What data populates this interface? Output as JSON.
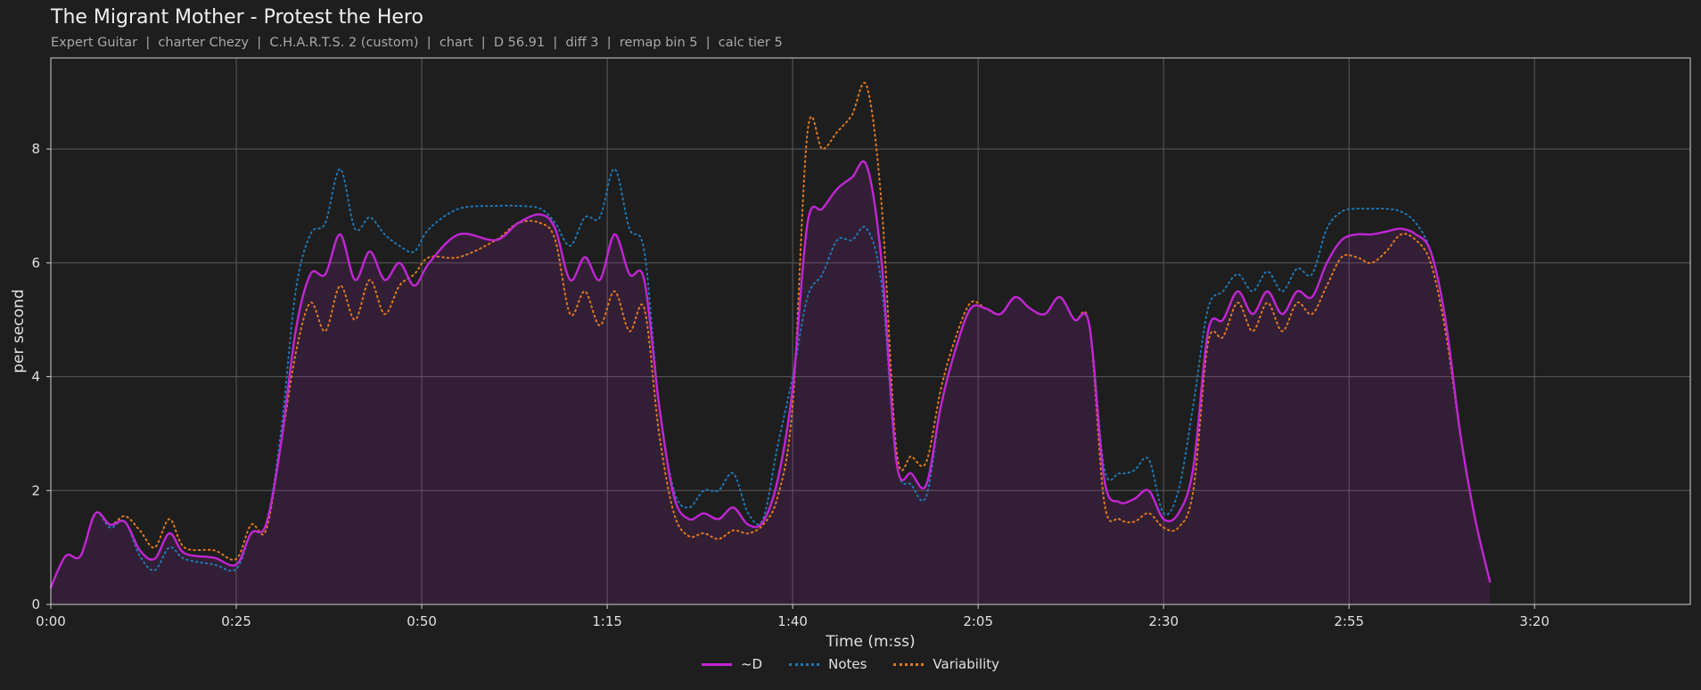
{
  "header": {
    "title": "The Migrant Mother - Protest the Hero",
    "subtitle": "Expert Guitar  |  charter Chezy  |  C.H.A.R.T.S. 2 (custom)  |  chart  |  D 56.91  |  diff 3  |  remap bin 5  |  calc tier 5"
  },
  "chart_data": {
    "type": "line",
    "title": "The Migrant Mother - Protest the Hero",
    "xlabel": "Time (m:ss)",
    "ylabel": "per second",
    "xlim": [
      0,
      221
    ],
    "ylim": [
      0,
      9.6
    ],
    "grid": true,
    "legend_position": "bottom-center",
    "x_ticks": [
      {
        "value": 0,
        "label": "0:00"
      },
      {
        "value": 25,
        "label": "0:25"
      },
      {
        "value": 50,
        "label": "0:50"
      },
      {
        "value": 75,
        "label": "1:15"
      },
      {
        "value": 100,
        "label": "1:40"
      },
      {
        "value": 125,
        "label": "2:05"
      },
      {
        "value": 150,
        "label": "2:30"
      },
      {
        "value": 175,
        "label": "2:55"
      },
      {
        "value": 200,
        "label": "3:20"
      }
    ],
    "y_ticks": [
      0,
      2,
      4,
      6,
      8
    ],
    "series": [
      {
        "name": "~D",
        "color": "#c026d3",
        "style": "solid",
        "fill": true,
        "points": [
          [
            0,
            0.3
          ],
          [
            2,
            0.85
          ],
          [
            4,
            0.85
          ],
          [
            6,
            1.6
          ],
          [
            8,
            1.4
          ],
          [
            10,
            1.45
          ],
          [
            12,
            0.95
          ],
          [
            14,
            0.8
          ],
          [
            16,
            1.25
          ],
          [
            18,
            0.9
          ],
          [
            22,
            0.82
          ],
          [
            25,
            0.7
          ],
          [
            27,
            1.25
          ],
          [
            29,
            1.4
          ],
          [
            31,
            2.8
          ],
          [
            33,
            4.8
          ],
          [
            35,
            5.8
          ],
          [
            37,
            5.8
          ],
          [
            39,
            6.5
          ],
          [
            41,
            5.7
          ],
          [
            43,
            6.2
          ],
          [
            45,
            5.7
          ],
          [
            47,
            6.0
          ],
          [
            49,
            5.6
          ],
          [
            51,
            6.0
          ],
          [
            55,
            6.5
          ],
          [
            60,
            6.4
          ],
          [
            63,
            6.7
          ],
          [
            66,
            6.85
          ],
          [
            68,
            6.6
          ],
          [
            70,
            5.7
          ],
          [
            72,
            6.1
          ],
          [
            74,
            5.7
          ],
          [
            76,
            6.5
          ],
          [
            78,
            5.8
          ],
          [
            80,
            5.7
          ],
          [
            82,
            3.5
          ],
          [
            84,
            1.9
          ],
          [
            86,
            1.5
          ],
          [
            88,
            1.6
          ],
          [
            90,
            1.5
          ],
          [
            92,
            1.7
          ],
          [
            94,
            1.4
          ],
          [
            96,
            1.45
          ],
          [
            98,
            2.2
          ],
          [
            100,
            3.8
          ],
          [
            102,
            6.7
          ],
          [
            104,
            6.95
          ],
          [
            106,
            7.3
          ],
          [
            108,
            7.5
          ],
          [
            110,
            7.7
          ],
          [
            112,
            6.0
          ],
          [
            114,
            2.5
          ],
          [
            116,
            2.3
          ],
          [
            118,
            2.1
          ],
          [
            120,
            3.5
          ],
          [
            122,
            4.5
          ],
          [
            124,
            5.2
          ],
          [
            126,
            5.2
          ],
          [
            128,
            5.1
          ],
          [
            130,
            5.4
          ],
          [
            132,
            5.2
          ],
          [
            134,
            5.1
          ],
          [
            136,
            5.4
          ],
          [
            138,
            5.0
          ],
          [
            140,
            4.9
          ],
          [
            142,
            2.2
          ],
          [
            144,
            1.8
          ],
          [
            146,
            1.85
          ],
          [
            148,
            2.0
          ],
          [
            150,
            1.5
          ],
          [
            152,
            1.6
          ],
          [
            154,
            2.4
          ],
          [
            156,
            4.8
          ],
          [
            158,
            5.0
          ],
          [
            160,
            5.5
          ],
          [
            162,
            5.1
          ],
          [
            164,
            5.5
          ],
          [
            166,
            5.1
          ],
          [
            168,
            5.5
          ],
          [
            170,
            5.4
          ],
          [
            172,
            6.0
          ],
          [
            174,
            6.4
          ],
          [
            176,
            6.5
          ],
          [
            178,
            6.5
          ],
          [
            180,
            6.55
          ],
          [
            182,
            6.6
          ],
          [
            184,
            6.5
          ],
          [
            186,
            6.2
          ],
          [
            188,
            5.0
          ],
          [
            190,
            3.0
          ],
          [
            192,
            1.5
          ],
          [
            194,
            0.4
          ]
        ]
      },
      {
        "name": "Notes",
        "color": "#1f77b4",
        "style": "dotted",
        "fill": false,
        "points": [
          [
            0,
            0.3
          ],
          [
            2,
            0.85
          ],
          [
            4,
            0.85
          ],
          [
            6,
            1.6
          ],
          [
            8,
            1.35
          ],
          [
            10,
            1.45
          ],
          [
            12,
            0.85
          ],
          [
            14,
            0.6
          ],
          [
            16,
            1.0
          ],
          [
            18,
            0.8
          ],
          [
            22,
            0.7
          ],
          [
            25,
            0.62
          ],
          [
            27,
            1.25
          ],
          [
            29,
            1.4
          ],
          [
            31,
            3.0
          ],
          [
            33,
            5.5
          ],
          [
            35,
            6.5
          ],
          [
            37,
            6.7
          ],
          [
            39,
            7.65
          ],
          [
            41,
            6.6
          ],
          [
            43,
            6.8
          ],
          [
            45,
            6.5
          ],
          [
            47,
            6.3
          ],
          [
            49,
            6.2
          ],
          [
            51,
            6.6
          ],
          [
            55,
            6.95
          ],
          [
            60,
            7.0
          ],
          [
            63,
            7.0
          ],
          [
            66,
            6.95
          ],
          [
            68,
            6.7
          ],
          [
            70,
            6.3
          ],
          [
            72,
            6.8
          ],
          [
            74,
            6.8
          ],
          [
            76,
            7.65
          ],
          [
            78,
            6.6
          ],
          [
            80,
            6.2
          ],
          [
            82,
            3.5
          ],
          [
            84,
            2.0
          ],
          [
            86,
            1.7
          ],
          [
            88,
            2.0
          ],
          [
            90,
            2.0
          ],
          [
            92,
            2.3
          ],
          [
            94,
            1.6
          ],
          [
            96,
            1.5
          ],
          [
            98,
            2.8
          ],
          [
            100,
            4.0
          ],
          [
            102,
            5.4
          ],
          [
            104,
            5.8
          ],
          [
            106,
            6.4
          ],
          [
            108,
            6.4
          ],
          [
            110,
            6.6
          ],
          [
            112,
            5.6
          ],
          [
            114,
            2.5
          ],
          [
            116,
            2.1
          ],
          [
            118,
            1.9
          ],
          [
            120,
            3.5
          ],
          [
            122,
            4.5
          ],
          [
            124,
            5.2
          ],
          [
            126,
            5.2
          ],
          [
            128,
            5.1
          ],
          [
            130,
            5.4
          ],
          [
            132,
            5.2
          ],
          [
            134,
            5.1
          ],
          [
            136,
            5.4
          ],
          [
            138,
            5.0
          ],
          [
            140,
            4.9
          ],
          [
            142,
            2.4
          ],
          [
            144,
            2.3
          ],
          [
            146,
            2.35
          ],
          [
            148,
            2.55
          ],
          [
            150,
            1.6
          ],
          [
            152,
            2.0
          ],
          [
            154,
            3.5
          ],
          [
            156,
            5.2
          ],
          [
            158,
            5.5
          ],
          [
            160,
            5.8
          ],
          [
            162,
            5.5
          ],
          [
            164,
            5.85
          ],
          [
            166,
            5.5
          ],
          [
            168,
            5.9
          ],
          [
            170,
            5.8
          ],
          [
            172,
            6.6
          ],
          [
            174,
            6.9
          ],
          [
            176,
            6.95
          ],
          [
            178,
            6.95
          ],
          [
            180,
            6.95
          ],
          [
            182,
            6.9
          ],
          [
            184,
            6.7
          ],
          [
            186,
            6.2
          ],
          [
            188,
            5.0
          ],
          [
            190,
            3.0
          ],
          [
            192,
            1.5
          ],
          [
            194,
            0.4
          ]
        ]
      },
      {
        "name": "Variability",
        "color": "#e07a1f",
        "style": "dotted",
        "fill": false,
        "points": [
          [
            0,
            0.3
          ],
          [
            2,
            0.85
          ],
          [
            4,
            0.85
          ],
          [
            6,
            1.6
          ],
          [
            8,
            1.4
          ],
          [
            10,
            1.55
          ],
          [
            12,
            1.3
          ],
          [
            14,
            1.0
          ],
          [
            16,
            1.5
          ],
          [
            18,
            1.0
          ],
          [
            22,
            0.95
          ],
          [
            25,
            0.8
          ],
          [
            27,
            1.4
          ],
          [
            29,
            1.3
          ],
          [
            31,
            2.8
          ],
          [
            33,
            4.4
          ],
          [
            35,
            5.3
          ],
          [
            37,
            4.8
          ],
          [
            39,
            5.6
          ],
          [
            41,
            5.0
          ],
          [
            43,
            5.7
          ],
          [
            45,
            5.1
          ],
          [
            47,
            5.6
          ],
          [
            49,
            5.8
          ],
          [
            51,
            6.1
          ],
          [
            55,
            6.1
          ],
          [
            60,
            6.4
          ],
          [
            63,
            6.7
          ],
          [
            66,
            6.7
          ],
          [
            68,
            6.4
          ],
          [
            70,
            5.1
          ],
          [
            72,
            5.5
          ],
          [
            74,
            4.9
          ],
          [
            76,
            5.5
          ],
          [
            78,
            4.8
          ],
          [
            80,
            5.2
          ],
          [
            82,
            3.0
          ],
          [
            84,
            1.6
          ],
          [
            86,
            1.2
          ],
          [
            88,
            1.25
          ],
          [
            90,
            1.15
          ],
          [
            92,
            1.3
          ],
          [
            94,
            1.25
          ],
          [
            96,
            1.4
          ],
          [
            98,
            1.9
          ],
          [
            100,
            3.5
          ],
          [
            102,
            8.3
          ],
          [
            104,
            8.0
          ],
          [
            106,
            8.3
          ],
          [
            108,
            8.6
          ],
          [
            110,
            9.1
          ],
          [
            112,
            7.0
          ],
          [
            114,
            2.7
          ],
          [
            116,
            2.6
          ],
          [
            118,
            2.5
          ],
          [
            120,
            3.8
          ],
          [
            122,
            4.7
          ],
          [
            124,
            5.3
          ],
          [
            126,
            5.2
          ],
          [
            128,
            5.1
          ],
          [
            130,
            5.4
          ],
          [
            132,
            5.2
          ],
          [
            134,
            5.1
          ],
          [
            136,
            5.4
          ],
          [
            138,
            5.0
          ],
          [
            140,
            4.9
          ],
          [
            142,
            1.8
          ],
          [
            144,
            1.5
          ],
          [
            146,
            1.45
          ],
          [
            148,
            1.6
          ],
          [
            150,
            1.35
          ],
          [
            152,
            1.35
          ],
          [
            154,
            2.0
          ],
          [
            156,
            4.6
          ],
          [
            158,
            4.7
          ],
          [
            160,
            5.3
          ],
          [
            162,
            4.8
          ],
          [
            164,
            5.3
          ],
          [
            166,
            4.8
          ],
          [
            168,
            5.3
          ],
          [
            170,
            5.1
          ],
          [
            172,
            5.6
          ],
          [
            174,
            6.1
          ],
          [
            176,
            6.1
          ],
          [
            178,
            6.0
          ],
          [
            180,
            6.2
          ],
          [
            182,
            6.5
          ],
          [
            184,
            6.4
          ],
          [
            186,
            6.0
          ],
          [
            188,
            4.8
          ],
          [
            190,
            3.0
          ],
          [
            192,
            1.5
          ],
          [
            194,
            0.4
          ]
        ]
      }
    ]
  }
}
